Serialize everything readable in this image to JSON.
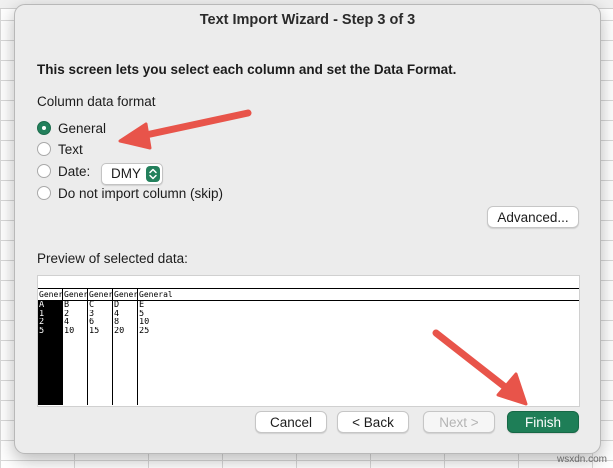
{
  "window": {
    "title": "Text Import Wizard - Step 3 of 3"
  },
  "instruction": "This screen lets you select each column and set the Data Format.",
  "column_format": {
    "label": "Column data format",
    "options": [
      {
        "label": "General",
        "checked": true
      },
      {
        "label": "Text",
        "checked": false
      },
      {
        "label": "Date:",
        "checked": false
      },
      {
        "label": "Do not import column (skip)",
        "checked": false
      }
    ],
    "date_value": "DMY"
  },
  "advanced_label": "Advanced...",
  "preview": {
    "label": "Preview of selected data:",
    "headers": [
      "General",
      "General",
      "General",
      "General",
      "General"
    ],
    "columns": [
      [
        "A",
        "1",
        "2",
        "5"
      ],
      [
        "B",
        "2",
        "4",
        "10"
      ],
      [
        "C",
        "3",
        "6",
        "15"
      ],
      [
        "D",
        "4",
        "8",
        "20"
      ],
      [
        "E",
        "5",
        "10",
        "25"
      ]
    ],
    "selected_column": 0
  },
  "buttons": {
    "cancel": "Cancel",
    "back": "< Back",
    "next": "Next >",
    "finish": "Finish"
  },
  "colors": {
    "accent": "#1e7e57",
    "annotation_arrow": "#e8544a"
  },
  "watermark": "wsxdn.com"
}
